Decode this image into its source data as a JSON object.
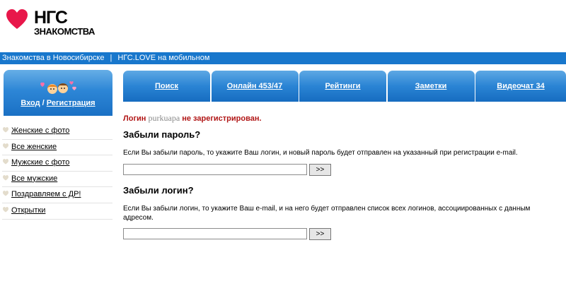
{
  "logo": {
    "line1": "НГС",
    "line2": "ЗНАКОМСТВА",
    "brand_color": "#e8174a"
  },
  "topbar": {
    "link1": "Знакомства в Новосибирске",
    "separator": "|",
    "link2": "НГС.LOVE на мобильном"
  },
  "login_box": {
    "login": "Вход",
    "slash": "/",
    "register": "Регистрация"
  },
  "sidebar": {
    "items": [
      {
        "label": "Женские с фото"
      },
      {
        "label": "Все женские"
      },
      {
        "label": "Мужские с фото"
      },
      {
        "label": "Все мужские"
      },
      {
        "label": "Поздравляем с ДР!"
      },
      {
        "label": "Открытки"
      }
    ]
  },
  "tabs": [
    {
      "label": "Поиск"
    },
    {
      "label": "Онлайн 453/47"
    },
    {
      "label": "Рейтинги"
    },
    {
      "label": "Заметки"
    },
    {
      "label": "Видеочат 34"
    }
  ],
  "main": {
    "notice_prefix": "Логин",
    "notice_user": "purkuapa",
    "notice_suffix": "не зарегистрирован.",
    "forgot_password_title": "Забыли пароль?",
    "forgot_password_text": "Если Вы забыли пароль, то укажите Ваш логин, и новый пароль будет отправлен на указанный при регистрации e-mail.",
    "forgot_password_button": ">>",
    "forgot_login_title": "Забыли логин?",
    "forgot_login_text": "Если Вы забыли логин, то укажите Ваш e-mail, и на него будет отправлен список всех логинов, ассоциированных с данным адресом.",
    "forgot_login_button": ">>"
  }
}
